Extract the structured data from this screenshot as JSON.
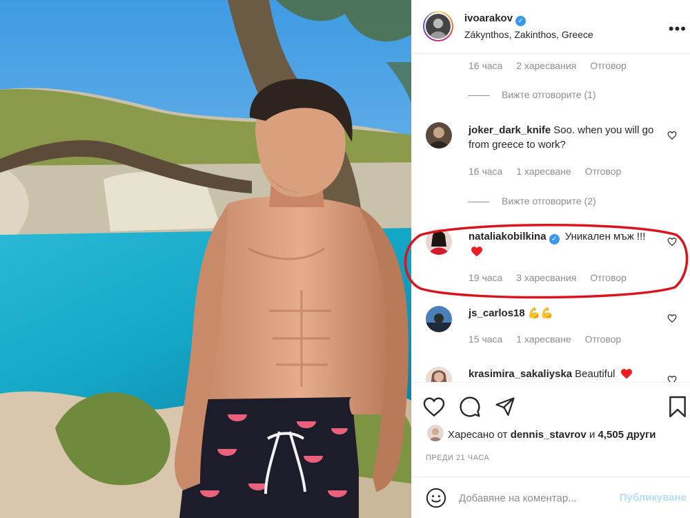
{
  "header": {
    "username": "ivoarakov",
    "location": "Zákynthos, Zakinthos, Greece"
  },
  "comments": {
    "partial_top": {
      "time": "16 часа",
      "likes": "2 харесвания",
      "reply": "Отговор",
      "view_replies": "Вижте отговорите (1)"
    },
    "items": [
      {
        "username": "joker_dark_knife",
        "text": "Soo. when you will go from greece to work?",
        "time": "16 часа",
        "likes": "1 харесване",
        "reply": "Отговор",
        "view_replies": "Вижте отговорите (2)"
      },
      {
        "username": "nataliakobilkina",
        "text": "Уникален мъж !!!",
        "time": "19 часа",
        "likes": "3 харесвания",
        "reply": "Отговор"
      },
      {
        "username": "js_carlos18",
        "text": "💪💪",
        "time": "15 часа",
        "likes": "1 харесване",
        "reply": "Отговор"
      },
      {
        "username": "krasimira_sakaliyska",
        "text": "Beautiful"
      }
    ]
  },
  "actions": {
    "liked_by_prefix": "Харесано от",
    "liked_by_user": "dennis_stavrov",
    "liked_by_conj": "и",
    "liked_by_others": "4,505 други",
    "time_ago": "ПРЕДИ 21 ЧАСА"
  },
  "add_comment": {
    "placeholder": "Добавяне на коментар...",
    "publish_label": "Публикуване"
  },
  "colors": {
    "verified": "#3897f0",
    "heart_red": "#ed1c24",
    "annotation_oval": "#d9141e",
    "muted_text": "#8e8e8e"
  },
  "icons": [
    "more-options-icon",
    "verified-icon",
    "heart-icon",
    "comment-icon",
    "share-icon",
    "bookmark-icon",
    "emoji-icon"
  ]
}
